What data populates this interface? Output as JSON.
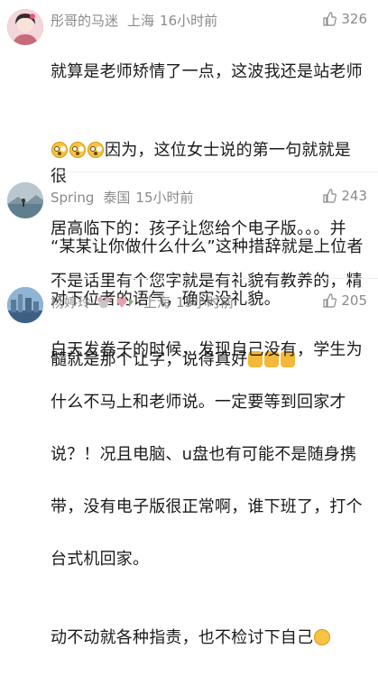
{
  "comments": [
    {
      "username": "彤哥的马迷",
      "location": "上海",
      "time": "16小时前",
      "likes": "326",
      "line1": "就算是老师矫情了一点，这波我还是站老师",
      "line2": "因为，这位女士说的第一句就就是很",
      "line3": "居高临下的：孩子让您给个电子版。。。并",
      "line4": "不是话里有个您字就是有礼貌有教养的，精",
      "line5": "髓就是那个让字，说得真好",
      "avatar_color": "#c86b7a",
      "emoji_names": [
        "shocked-face-icon",
        "thumbs-up-icon"
      ]
    },
    {
      "username": "Spring",
      "location": "泰国",
      "time": "15小时前",
      "likes": "243",
      "line1": "“某某让你做什么什么”这种措辞就是上位者",
      "line2": "对下位者的语气，确实没礼貌。",
      "avatar_color": "#6f8fa0"
    },
    {
      "username": "杨婷玲",
      "location": "上海",
      "time": "15小时前",
      "likes": "205",
      "line1": "白天发卷子的时候，发现自己没有，学生为",
      "line2": "什么不马上和老师说。一定要等到回家才",
      "line3": "说？！况且电脑、u盘也有可能不是随身携",
      "line4": "带，没有电子版很正常啊，谁下班了，打个",
      "line5": "台式机回家。",
      "line6": "动不动就各种指责，也不检讨下自己",
      "avatar_color": "#4f7ea8"
    }
  ]
}
